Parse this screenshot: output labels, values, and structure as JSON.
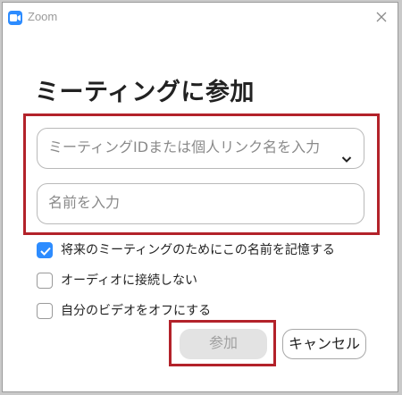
{
  "window": {
    "app_title": "Zoom"
  },
  "dialog": {
    "heading": "ミーティングに参加",
    "meeting_field": {
      "placeholder": "ミーティングIDまたは個人リンク名を入力"
    },
    "name_field": {
      "placeholder": "名前を入力"
    },
    "options": [
      {
        "label": "将来のミーティングのためにこの名前を記憶する",
        "checked": true
      },
      {
        "label": "オーディオに接続しない",
        "checked": false
      },
      {
        "label": "自分のビデオをオフにする",
        "checked": false
      }
    ],
    "join_button": "参加",
    "cancel_button": "キャンセル"
  },
  "colors": {
    "accent": "#2d8cff",
    "highlight": "#b3222a",
    "disabled_button": "#e3e3e3"
  },
  "icons": [
    "zoom-app-icon",
    "close-icon",
    "chevron-down-icon",
    "checkmark-icon"
  ]
}
